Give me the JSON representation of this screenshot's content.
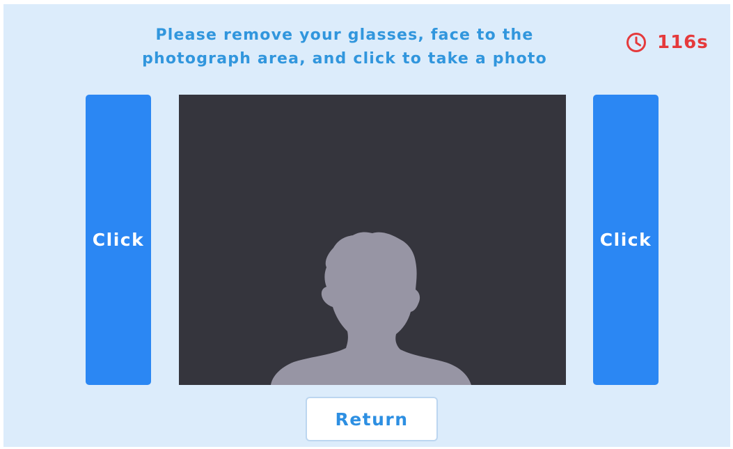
{
  "instructions": {
    "line1": "Please remove your glasses, face to the",
    "line2": "photograph area, and click to take a photo"
  },
  "timer": {
    "icon": "clock-icon",
    "value": "116s",
    "color": "#e53a3c"
  },
  "buttons": {
    "left_click_label": "Click",
    "right_click_label": "Click",
    "return_label": "Return"
  },
  "camera": {
    "placeholder_icon": "person-silhouette-icon"
  },
  "colors": {
    "background": "#dcecfb",
    "accent": "#2b87f3",
    "instruction_text": "#3196dd",
    "camera_background": "#35353d",
    "silhouette": "#9795a4"
  }
}
